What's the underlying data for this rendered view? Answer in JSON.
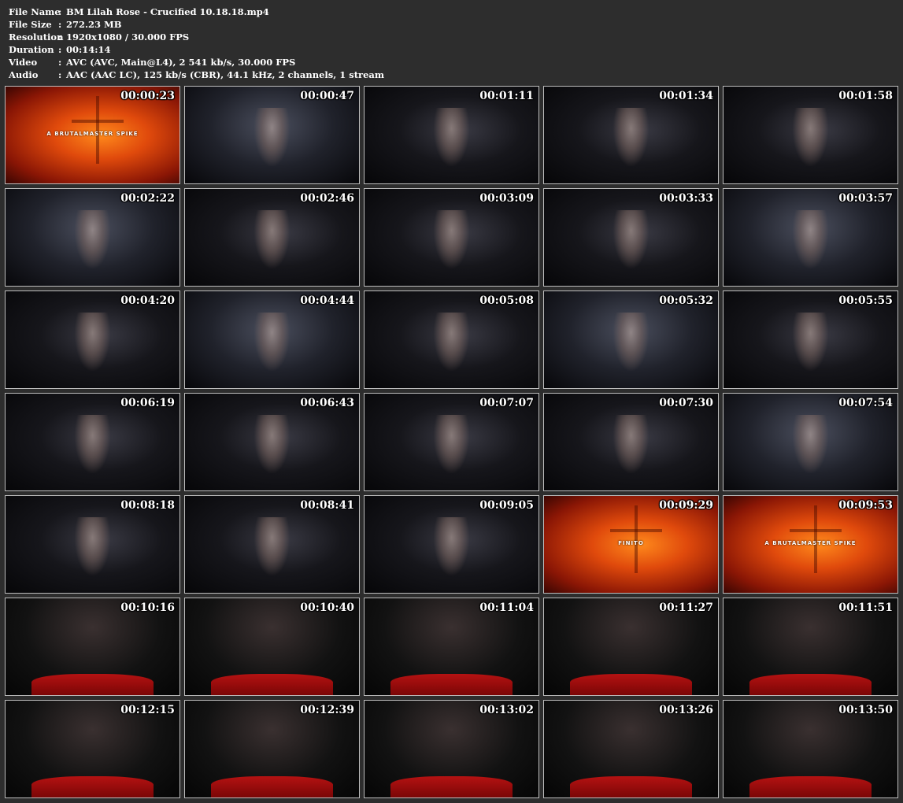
{
  "info": [
    {
      "key": "File Name",
      "sep": ":",
      "value": "BM Lilah Rose - Crucified 10.18.18.mp4"
    },
    {
      "key": "File Size",
      "sep": ":",
      "value": "272.23 MB"
    },
    {
      "key": "Resolution",
      "sep": ":",
      "value": "1920x1080 / 30.000 FPS"
    },
    {
      "key": "Duration",
      "sep": ":",
      "value": "00:14:14"
    },
    {
      "key": "Video",
      "sep": ":",
      "value": "AVC (AVC, Main@L4), 2 541 kb/s, 30.000 FPS"
    },
    {
      "key": "Audio",
      "sep": ":",
      "value": "AAC (AAC LC), 125 kb/s (CBR), 44.1 kHz, 2 channels, 1 stream"
    }
  ],
  "thumbnails": [
    {
      "time": "00:00:23",
      "scene": "fire",
      "overlay": "A BRUTALMASTER SPIKE"
    },
    {
      "time": "00:00:47",
      "scene": "stage"
    },
    {
      "time": "00:01:11",
      "scene": "dark"
    },
    {
      "time": "00:01:34",
      "scene": "dark"
    },
    {
      "time": "00:01:58",
      "scene": "dark"
    },
    {
      "time": "00:02:22",
      "scene": "stage"
    },
    {
      "time": "00:02:46",
      "scene": "dark"
    },
    {
      "time": "00:03:09",
      "scene": "dark"
    },
    {
      "time": "00:03:33",
      "scene": "dark"
    },
    {
      "time": "00:03:57",
      "scene": "stage"
    },
    {
      "time": "00:04:20",
      "scene": "dark"
    },
    {
      "time": "00:04:44",
      "scene": "stage"
    },
    {
      "time": "00:05:08",
      "scene": "dark"
    },
    {
      "time": "00:05:32",
      "scene": "stage"
    },
    {
      "time": "00:05:55",
      "scene": "dark"
    },
    {
      "time": "00:06:19",
      "scene": "dark"
    },
    {
      "time": "00:06:43",
      "scene": "dark"
    },
    {
      "time": "00:07:07",
      "scene": "dark"
    },
    {
      "time": "00:07:30",
      "scene": "dark"
    },
    {
      "time": "00:07:54",
      "scene": "stage"
    },
    {
      "time": "00:08:18",
      "scene": "dark"
    },
    {
      "time": "00:08:41",
      "scene": "dark"
    },
    {
      "time": "00:09:05",
      "scene": "dark"
    },
    {
      "time": "00:09:29",
      "scene": "fire",
      "overlay": "FINITO"
    },
    {
      "time": "00:09:53",
      "scene": "fire",
      "overlay": "A BRUTALMASTER SPIKE"
    },
    {
      "time": "00:10:16",
      "scene": "red"
    },
    {
      "time": "00:10:40",
      "scene": "red"
    },
    {
      "time": "00:11:04",
      "scene": "red"
    },
    {
      "time": "00:11:27",
      "scene": "red"
    },
    {
      "time": "00:11:51",
      "scene": "red"
    },
    {
      "time": "00:12:15",
      "scene": "red"
    },
    {
      "time": "00:12:39",
      "scene": "red"
    },
    {
      "time": "00:13:02",
      "scene": "red"
    },
    {
      "time": "00:13:26",
      "scene": "red"
    },
    {
      "time": "00:13:50",
      "scene": "red"
    }
  ]
}
